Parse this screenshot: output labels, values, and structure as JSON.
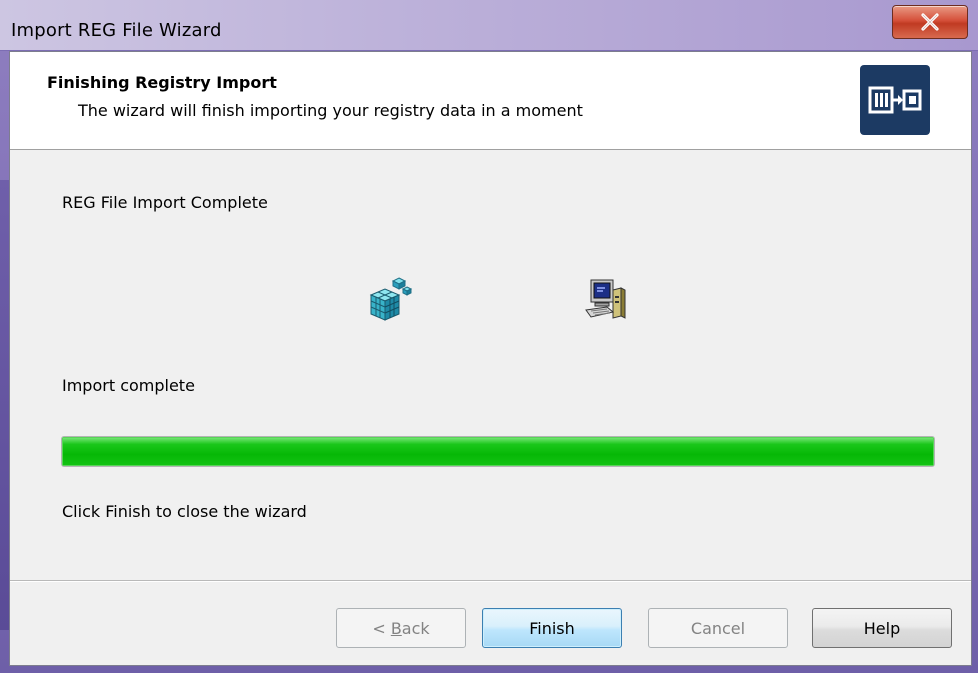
{
  "window": {
    "title": "Import REG File Wizard"
  },
  "header": {
    "title": "Finishing Registry Import",
    "subtitle": "The wizard will finish importing your registry data in a moment"
  },
  "main": {
    "section_label": "REG File Import Complete",
    "status_label": "Import complete",
    "progress": {
      "percent": 100,
      "color": "#06b806"
    },
    "instruction": "Click Finish to close the wizard"
  },
  "icons": {
    "header": "wizard-logo-icon",
    "registry": "registry-cubes-icon",
    "computer": "computer-icon",
    "close": "close-icon"
  },
  "buttons": {
    "back": {
      "prefix": "< ",
      "accel": "B",
      "rest": "ack",
      "enabled": false
    },
    "finish": {
      "label": "Finish",
      "enabled": true
    },
    "cancel": {
      "label": "Cancel",
      "enabled": false
    },
    "help": {
      "label": "Help",
      "enabled": true
    }
  }
}
